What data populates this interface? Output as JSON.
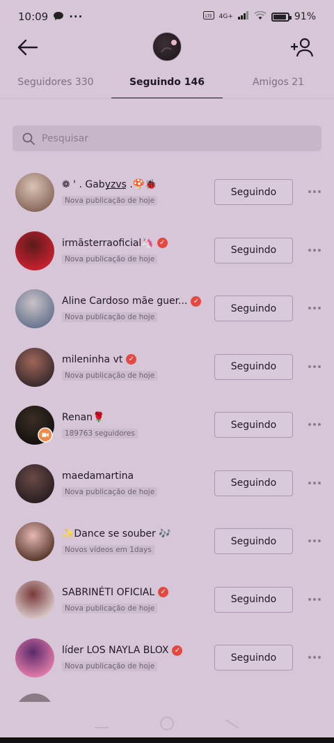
{
  "status": {
    "time": "10:09",
    "battery_pct": "91%",
    "battery_level": 0.91,
    "network": "4G+"
  },
  "tabs": [
    {
      "label": "Seguidores 330",
      "active": false
    },
    {
      "label": "Seguindo 146",
      "active": true
    },
    {
      "label": "Amigos 21",
      "active": false
    }
  ],
  "search": {
    "placeholder": "Pesquisar"
  },
  "follow_button_label": "Seguindo",
  "users": [
    {
      "name": "❁ ' . Gaby͟z͟v͟s .🍄🐞",
      "subtitle": "Nova publicação de hoje",
      "verified": false,
      "avatar_colors": [
        "#8a6b5e",
        "#d9c3b5"
      ]
    },
    {
      "name": "irmãsterraoficial🦄",
      "subtitle": "Nova publicação de hoje",
      "verified": true,
      "avatar_colors": [
        "#c8202f",
        "#5a1c1c"
      ]
    },
    {
      "name": "Aline Cardoso mãe guer...",
      "subtitle": "Nova publicação de hoje",
      "verified": true,
      "avatar_colors": [
        "#6a7690",
        "#c9c2c7"
      ]
    },
    {
      "name": "mileninha vt",
      "subtitle": "Nova publicação de hoje",
      "verified": true,
      "avatar_colors": [
        "#3a2b2e",
        "#a0665a"
      ]
    },
    {
      "name": "Renan🌹",
      "subtitle": "189763 seguidores",
      "verified": false,
      "avatar_colors": [
        "#141110",
        "#3b2e24"
      ]
    },
    {
      "name": "maedamartina",
      "subtitle": "Nova publicação de hoje",
      "verified": false,
      "avatar_colors": [
        "#2a1f22",
        "#6a4a47"
      ]
    },
    {
      "name": "✨Dance se souber 🎶",
      "subtitle": "Novos vídeos em 1days",
      "verified": false,
      "avatar_colors": [
        "#5a3a2e",
        "#e6b8b4"
      ]
    },
    {
      "name": "SABRINÉTI OFICIAL",
      "subtitle": "Nova publicação de hoje",
      "verified": true,
      "avatar_colors": [
        "#d8c7c8",
        "#7a3a3a"
      ]
    },
    {
      "name": "líder LOS NAYLA BLOX",
      "subtitle": "Nova publicação de hoje",
      "verified": true,
      "avatar_colors": [
        "#e07aa8",
        "#5a2a6a"
      ]
    }
  ]
}
